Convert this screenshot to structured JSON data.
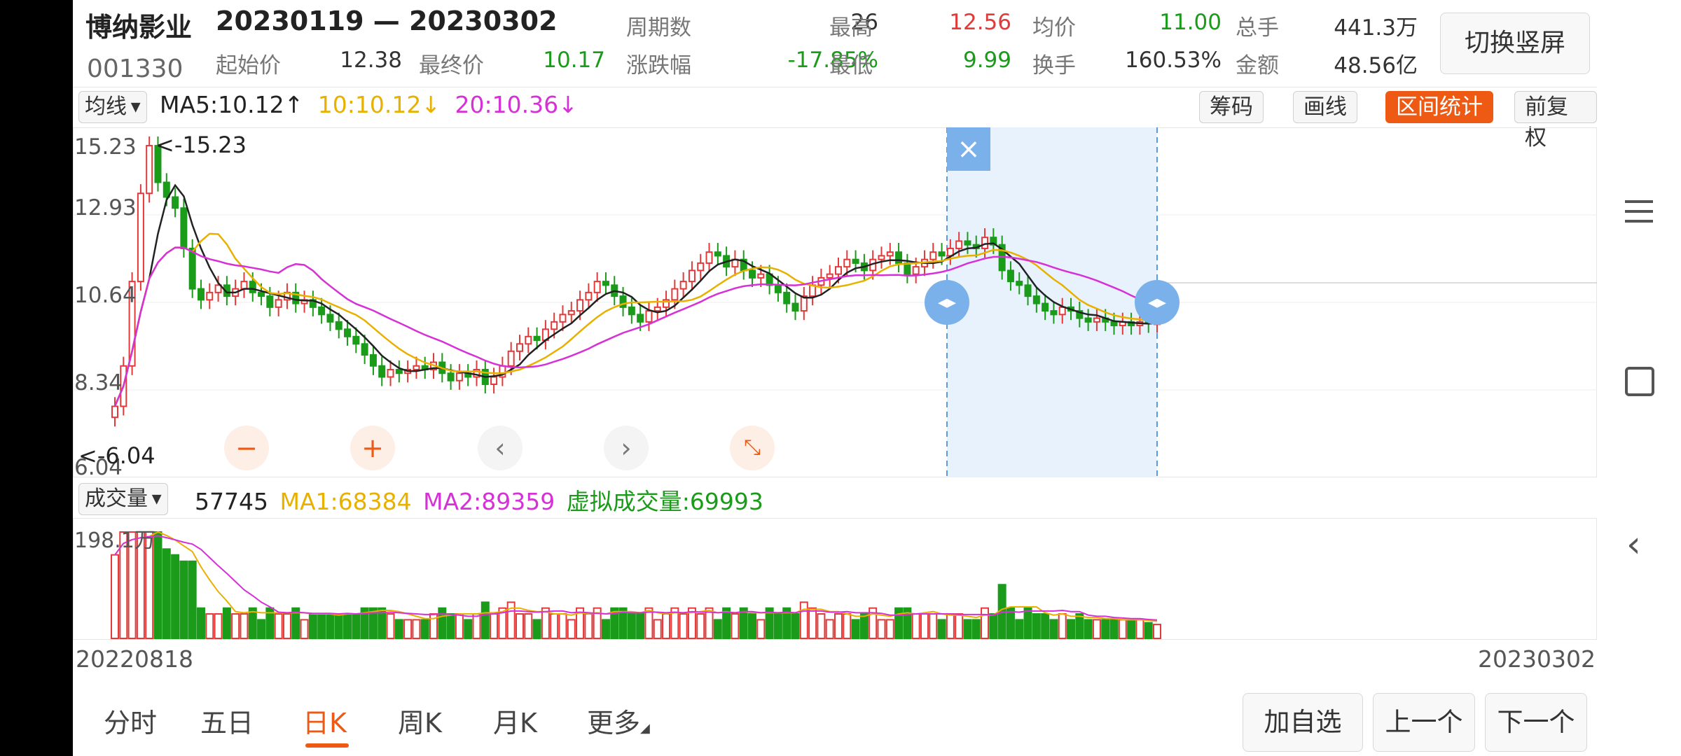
{
  "header": {
    "stock_name": "博纳影业",
    "date_range": "20230119 — 20230302",
    "stock_code": "001330",
    "stats": [
      {
        "label": "周期数",
        "value": "26"
      },
      {
        "label": "最高",
        "value": "12.56"
      },
      {
        "label": "均价",
        "value": "11.00"
      },
      {
        "label": "总手",
        "value": "441.3万"
      },
      {
        "label": "起始价",
        "value": "12.38"
      },
      {
        "label": "最终价",
        "value": "10.17"
      },
      {
        "label": "涨跌幅",
        "value": "-17.85%"
      },
      {
        "label": "最低",
        "value": "9.99"
      },
      {
        "label": "换手",
        "value": "160.53%"
      },
      {
        "label": "金额",
        "value": "48.56亿"
      }
    ],
    "switch_button": "切换竖屏"
  },
  "ma_bar": {
    "selector": "均线",
    "ma5": "MA5:10.12",
    "ma5_arrow": "↑",
    "ma10": "10:10.12",
    "ma10_arrow": "↓",
    "ma20": "20:10.36",
    "ma20_arrow": "↓",
    "tools": [
      "筹码",
      "画线",
      "区间统计",
      "前复权"
    ]
  },
  "price_axis": [
    "15.23",
    "12.93",
    "10.64",
    "8.34",
    "6.04"
  ],
  "price_marks": {
    "max": "<-15.23",
    "min": "<-6.04"
  },
  "volume_bar": {
    "selector": "成交量",
    "vol": "57745",
    "ma1": "MA1:68384",
    "ma2": "MA2:89359",
    "virtual": "虚拟成交量:69993",
    "axis_top": "198.1万"
  },
  "dates": {
    "start": "20220818",
    "end": "20230302"
  },
  "tabs": [
    "分时",
    "五日",
    "日K",
    "周K",
    "月K",
    "更多"
  ],
  "active_tab": "日K",
  "bottom_buttons": [
    "加自选",
    "上一个",
    "下一个"
  ],
  "colors": {
    "up": "#e23a3a",
    "down": "#1a9b1a",
    "ma5": "#222222",
    "ma10": "#e8b100",
    "ma20": "#d631d6",
    "accent": "#ee5a14",
    "selection": "#e8f2fd"
  },
  "chart_data": {
    "type": "candlestick",
    "ylim": [
      6.04,
      15.23
    ],
    "volume_max": "198.1万",
    "close": [
      7.9,
      9.0,
      11.3,
      13.7,
      15.0,
      14.0,
      13.6,
      13.3,
      12.2,
      11.1,
      10.8,
      11.0,
      11.2,
      10.9,
      11.1,
      11.3,
      11.0,
      10.9,
      10.6,
      10.8,
      11.0,
      10.7,
      10.8,
      10.6,
      10.4,
      10.2,
      10.0,
      9.8,
      9.6,
      9.3,
      9.0,
      8.7,
      8.9,
      8.8,
      8.9,
      9.0,
      8.9,
      9.1,
      8.8,
      8.6,
      8.8,
      8.7,
      8.9,
      8.5,
      8.7,
      9.0,
      9.4,
      9.6,
      9.8,
      9.7,
      10.0,
      10.2,
      10.4,
      10.5,
      10.8,
      11.0,
      11.3,
      11.2,
      10.9,
      10.6,
      10.4,
      10.2,
      10.5,
      10.6,
      10.8,
      11.1,
      11.3,
      11.6,
      11.8,
      12.1,
      12.0,
      11.7,
      11.9,
      11.6,
      11.4,
      11.5,
      11.2,
      11.0,
      10.7,
      10.5,
      10.9,
      11.2,
      11.4,
      11.5,
      11.7,
      11.9,
      11.8,
      11.6,
      11.9,
      12.0,
      12.1,
      11.8,
      11.5,
      11.7,
      11.9,
      12.1,
      12.0,
      12.2,
      12.4,
      12.3,
      12.2,
      12.5,
      12.3,
      11.6,
      11.3,
      11.2,
      10.9,
      10.7,
      10.5,
      10.4,
      10.6,
      10.5,
      10.3,
      10.2,
      10.3,
      10.2,
      10.1,
      10.2,
      10.1,
      10.2,
      10.15,
      10.17
    ]
  }
}
